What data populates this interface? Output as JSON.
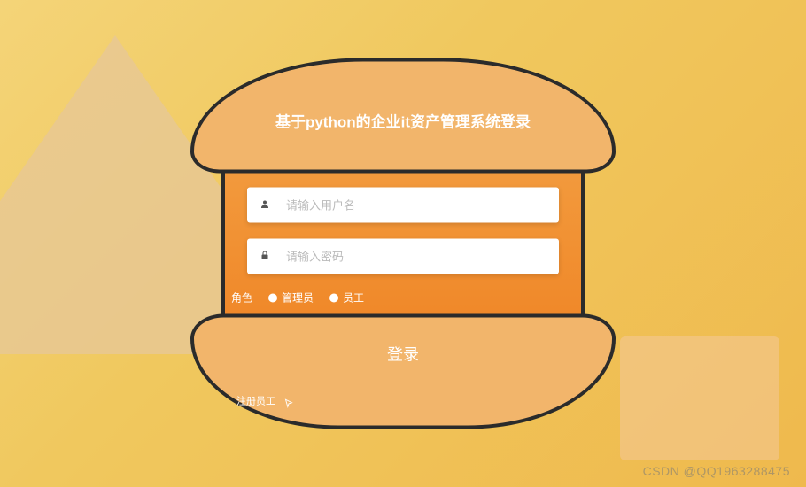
{
  "login": {
    "title": "基于python的企业it资产管理系统登录",
    "username_placeholder": "请输入用户名",
    "password_placeholder": "请输入密码",
    "role_label": "角色",
    "roles": {
      "admin": "管理员",
      "employee": "员工"
    },
    "login_button": "登录",
    "register_link": "注册员工"
  },
  "watermark": "CSDN @QQ1963288475"
}
